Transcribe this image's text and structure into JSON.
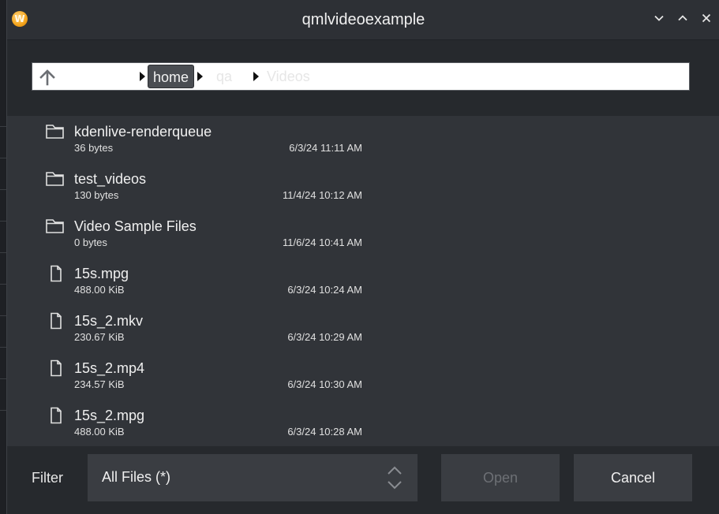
{
  "window": {
    "title": "qmlvideoexample",
    "app_icon_letter": "W"
  },
  "title_controls": {
    "minimize_icon": "chevron-down-icon",
    "maximize_icon": "chevron-up-icon",
    "close_icon": "close-icon"
  },
  "pathbar": {
    "up_icon": "arrow-up-icon",
    "crumbs": [
      {
        "label": "home"
      },
      {
        "label": "qa"
      },
      {
        "label": "Videos"
      }
    ]
  },
  "files": [
    {
      "name": "kdenlive-renderqueue",
      "size": "36 bytes",
      "date": "6/3/24 11:11 AM",
      "type": "folder"
    },
    {
      "name": "test_videos",
      "size": "130 bytes",
      "date": "11/4/24 10:12 AM",
      "type": "folder"
    },
    {
      "name": "Video Sample Files",
      "size": "0 bytes",
      "date": "11/6/24 10:41 AM",
      "type": "folder"
    },
    {
      "name": "15s.mpg",
      "size": "488.00 KiB",
      "date": "6/3/24 10:24 AM",
      "type": "file"
    },
    {
      "name": "15s_2.mkv",
      "size": "230.67 KiB",
      "date": "6/3/24 10:29 AM",
      "type": "file"
    },
    {
      "name": "15s_2.mp4",
      "size": "234.57 KiB",
      "date": "6/3/24 10:30 AM",
      "type": "file"
    },
    {
      "name": "15s_2.mpg",
      "size": "488.00 KiB",
      "date": "6/3/24 10:28 AM",
      "type": "file"
    }
  ],
  "footer": {
    "filter_label": "Filter",
    "filter_value": "All Files (*)",
    "open_label": "Open",
    "cancel_label": "Cancel"
  },
  "colors": {
    "background": "#2b2e33",
    "list_background": "#313439",
    "disabled_text": "#6d7075",
    "app_icon": "#f4a51c"
  }
}
